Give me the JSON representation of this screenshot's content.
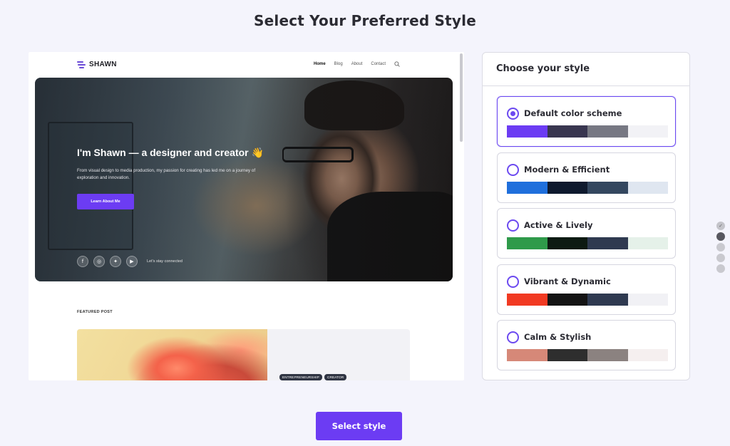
{
  "page": {
    "title": "Select Your Preferred Style"
  },
  "preview": {
    "site": {
      "logo_text": "SHAWN",
      "nav": [
        "Home",
        "Blog",
        "About",
        "Contact"
      ],
      "hero": {
        "heading": "I'm Shawn — a designer and creator 👋",
        "text": "From visual design to media production, my passion for creating has led me on a journey of exploration and innovation.",
        "cta": "Learn About Me",
        "social_icons": [
          "facebook-icon",
          "instagram-icon",
          "twitter-icon",
          "youtube-icon"
        ],
        "social_text": "Let's stay connected"
      },
      "featured": {
        "label": "FEATURED POST",
        "tags": [
          "ENTREPRENEURSHIP",
          "CREATOR"
        ]
      }
    }
  },
  "panel": {
    "title": "Choose your style",
    "options": [
      {
        "label": "Default color scheme",
        "selected": true,
        "colors": [
          "#6c3cf3",
          "#393650",
          "#777883",
          "#f2f2f6"
        ]
      },
      {
        "label": "Modern & Efficient",
        "selected": false,
        "colors": [
          "#1f6fdc",
          "#0f1a2e",
          "#34475f",
          "#dfe6f0"
        ]
      },
      {
        "label": "Active & Lively",
        "selected": false,
        "colors": [
          "#2f9a4a",
          "#0d1a12",
          "#2f3a50",
          "#e5f1e9"
        ]
      },
      {
        "label": "Vibrant & Dynamic",
        "selected": false,
        "colors": [
          "#f13a22",
          "#141414",
          "#2f3a50",
          "#f1f1f5"
        ]
      },
      {
        "label": "Calm & Stylish",
        "selected": false,
        "colors": [
          "#d68878",
          "#2e2e2e",
          "#8b8280",
          "#f5efef"
        ]
      }
    ]
  },
  "pager": {
    "steps": 5,
    "current": 2
  },
  "actions": {
    "select_label": "Select style"
  },
  "colors": {
    "accent": "#6c3cf3",
    "background": "#f4f4fc"
  }
}
